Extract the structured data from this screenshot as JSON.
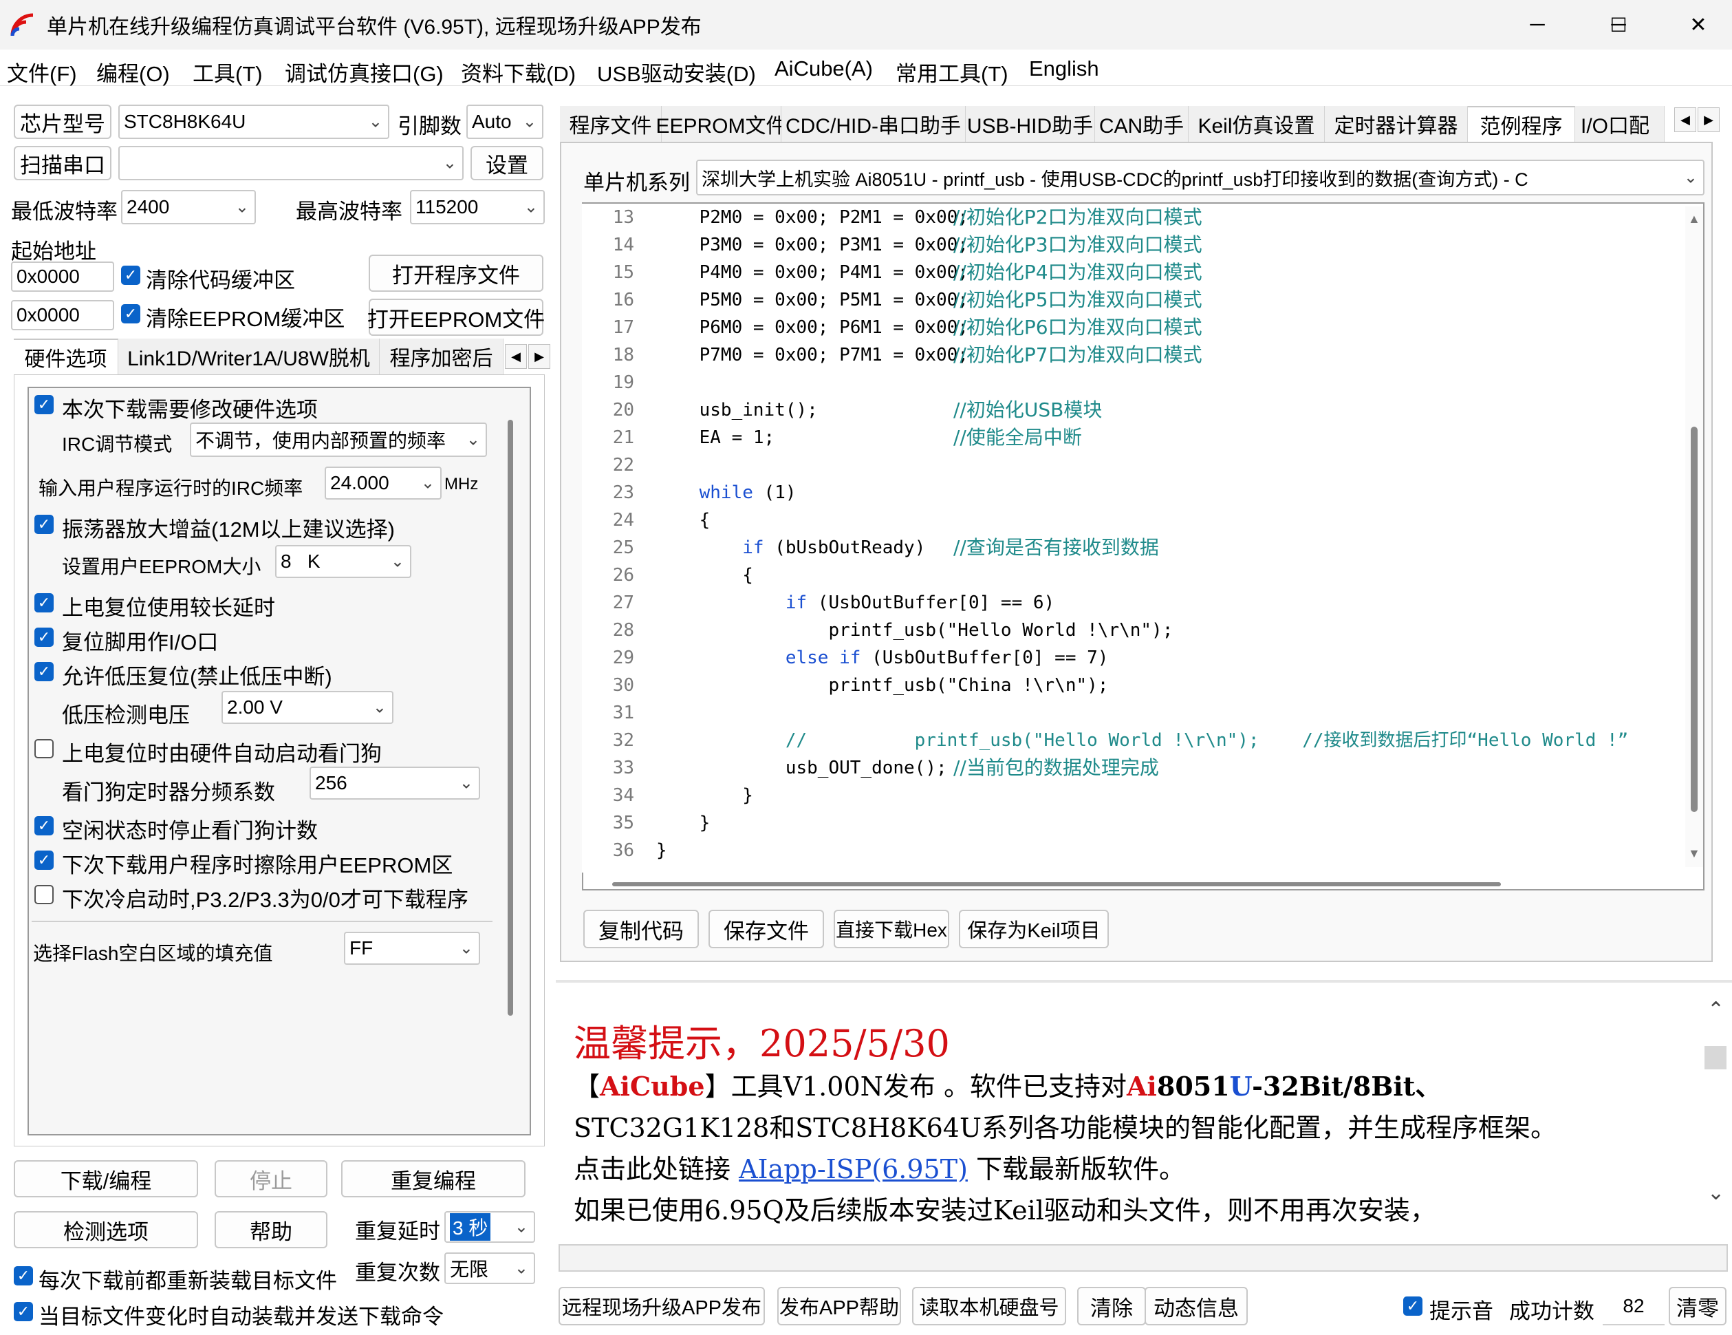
{
  "window": {
    "title": "单片机在线升级编程仿真调试平台软件 (V6.95T), 远程现场升级APP发布",
    "minimize": "─",
    "maximize": "☐",
    "close": "✕"
  },
  "menu": [
    "文件(F)",
    "编程(O)",
    "工具(T)",
    "调试仿真接口(G)",
    "资料下载(D)",
    "USB驱动安装(D)",
    "AiCube(A)",
    "常用工具(T)",
    "English"
  ],
  "left": {
    "chip_button": "芯片型号",
    "chip_value": "STC8H8K64U",
    "pins_label": "引脚数",
    "pins_value": "Auto",
    "scan_button": "扫描串口",
    "port_value": "",
    "settings_button": "设置",
    "min_baud_label": "最低波特率",
    "min_baud_value": "2400",
    "max_baud_label": "最高波特率",
    "max_baud_value": "115200",
    "start_addr_label": "起始地址",
    "addr1": "0x0000",
    "clear_code_label": "清除代码缓冲区",
    "open_prog_button": "打开程序文件",
    "addr2": "0x0000",
    "clear_eeprom_label": "清除EEPROM缓冲区",
    "open_eeprom_button": "打开EEPROM文件",
    "tabs": [
      "硬件选项",
      "Link1D/Writer1A/U8W脱机",
      "程序加密后"
    ],
    "hw": {
      "modify_hw": "本次下载需要修改硬件选项",
      "irc_mode_label": "IRC调节模式",
      "irc_mode_value": "不调节，使用内部预置的频率",
      "irc_freq_label": "输入用户程序运行时的IRC频率",
      "irc_freq_value": "24.000",
      "irc_freq_unit": "MHz",
      "osc_gain": "振荡器放大增益(12M以上建议选择)",
      "eeprom_size_label": "设置用户EEPROM大小",
      "eeprom_size_value": "8   K",
      "long_reset": "上电复位使用较长延时",
      "reset_io": "复位脚用作I/O口",
      "lvr": "允许低压复位(禁止低压中断)",
      "lvd_label": "低压检测电压",
      "lvd_value": "2.00 V",
      "wdt_auto": "上电复位时由硬件自动启动看门狗",
      "wdt_div_label": "看门狗定时器分频系数",
      "wdt_div_value": "256",
      "idle_wdt": "空闲状态时停止看门狗计数",
      "erase_eeprom": "下次下载用户程序时擦除用户EEPROM区",
      "cold_boot": "下次冷启动时,P3.2/P3.3为0/0才可下载程序",
      "flash_fill_label": "选择Flash空白区域的填充值",
      "flash_fill_value": "FF"
    },
    "download_button": "下载/编程",
    "stop_button": "停止",
    "reprogram_button": "重复编程",
    "check_button": "检测选项",
    "help_button": "帮助",
    "repeat_delay_label": "重复延时",
    "repeat_delay_value": "3 秒",
    "repeat_count_label": "重复次数",
    "repeat_count_value": "无限",
    "reload_label": "每次下载前都重新装载目标文件",
    "auto_load_label": "当目标文件变化时自动装载并发送下载命令"
  },
  "right": {
    "tabs": [
      "程序文件",
      "EEPROM文件",
      "CDC/HID-串口助手",
      "USB-HID助手",
      "CAN助手",
      "Keil仿真设置",
      "定时器计算器",
      "范例程序",
      "I/O口配"
    ],
    "series_label": "单片机系列",
    "series_value": "深圳大学上机实验 Ai8051U - printf_usb - 使用USB-CDC的printf_usb打印接收到的数据(查询方式) - C",
    "code_lines": [
      {
        "n": "13",
        "code": "    P2M0 = 0x00; P2M1 = 0x00;",
        "comment": "//初始化P2口为准双向口模式"
      },
      {
        "n": "14",
        "code": "    P3M0 = 0x00; P3M1 = 0x00;",
        "comment": "//初始化P3口为准双向口模式"
      },
      {
        "n": "15",
        "code": "    P4M0 = 0x00; P4M1 = 0x00;",
        "comment": "//初始化P4口为准双向口模式"
      },
      {
        "n": "16",
        "code": "    P5M0 = 0x00; P5M1 = 0x00;",
        "comment": "//初始化P5口为准双向口模式"
      },
      {
        "n": "17",
        "code": "    P6M0 = 0x00; P6M1 = 0x00;",
        "comment": "//初始化P6口为准双向口模式"
      },
      {
        "n": "18",
        "code": "    P7M0 = 0x00; P7M1 = 0x00;",
        "comment": "//初始化P7口为准双向口模式"
      },
      {
        "n": "19",
        "code": "",
        "comment": ""
      },
      {
        "n": "20",
        "code": "    usb_init();",
        "comment": "//初始化USB模块"
      },
      {
        "n": "21",
        "code": "    EA = 1;",
        "comment": "//使能全局中断"
      },
      {
        "n": "22",
        "code": "",
        "comment": ""
      },
      {
        "n": "23",
        "kw": "    while",
        "code": " (1)",
        "comment": ""
      },
      {
        "n": "24",
        "code": "    {",
        "comment": ""
      },
      {
        "n": "25",
        "kw": "        if",
        "code": " (bUsbOutReady)",
        "comment": "//查询是否有接收到数据"
      },
      {
        "n": "26",
        "code": "        {",
        "comment": ""
      },
      {
        "n": "27",
        "kw": "            if",
        "code": " (UsbOutBuffer[0] == 6)",
        "comment": ""
      },
      {
        "n": "28",
        "code": "                printf_usb(\"Hello World !\\r\\n\");",
        "comment": ""
      },
      {
        "n": "29",
        "kw": "            else if",
        "code": " (UsbOutBuffer[0] == 7)",
        "comment": ""
      },
      {
        "n": "30",
        "code": "                printf_usb(\"China !\\r\\n\");",
        "comment": ""
      },
      {
        "n": "31",
        "code": "",
        "comment": ""
      },
      {
        "n": "32",
        "code": "            //          printf_usb(\"Hello World !\\r\\n\");    //接收到数据后打印“Hello World !”",
        "comment": "",
        "allcomment": true
      },
      {
        "n": "33",
        "code": "            usb_OUT_done();",
        "comment": "//当前包的数据处理完成"
      },
      {
        "n": "34",
        "code": "        }",
        "comment": ""
      },
      {
        "n": "35",
        "code": "    }",
        "comment": ""
      },
      {
        "n": "36",
        "code": "}",
        "comment": ""
      }
    ],
    "copy_button": "复制代码",
    "save_button": "保存文件",
    "download_hex_button": "直接下载Hex",
    "save_keil_button": "保存为Keil项目"
  },
  "notice": {
    "title": "温馨提示，2025/5/30",
    "line1_a": "【",
    "line1_b": "AiCube",
    "line1_c": "】工具V1.00N发布 。软件已支持对",
    "line1_d": "Ai",
    "line1_e": "8051",
    "line1_f": "U",
    "line1_g": "-32Bit/8Bit、",
    "line2": "STC32G1K128和STC8H8K64U系列各功能模块的智能化配置，并生成程序框架。",
    "line3_a": "点击此处链接 ",
    "line3_link": "AIapp-ISP(6.95T)",
    "line3_b": " 下载最新版软件。",
    "line4": "如果已使用6.95Q及后续版本安装过Keil驱动和头文件，则不用再次安装，"
  },
  "bottom": {
    "remote_button": "远程现场升级APP发布",
    "publish_help_button": "发布APP帮助",
    "read_disk_button": "读取本机硬盘号",
    "clear_button": "清除",
    "dynamic_button": "动态信息",
    "beep_label": "提示音",
    "success_label": "成功计数",
    "success_value": "82",
    "clear_zero_button": "清零"
  },
  "colors": {
    "accent": "#0a63c9",
    "notice_red": "#d40f14",
    "notice_blue": "#1a4fd1",
    "comment": "#1f8a8a"
  }
}
